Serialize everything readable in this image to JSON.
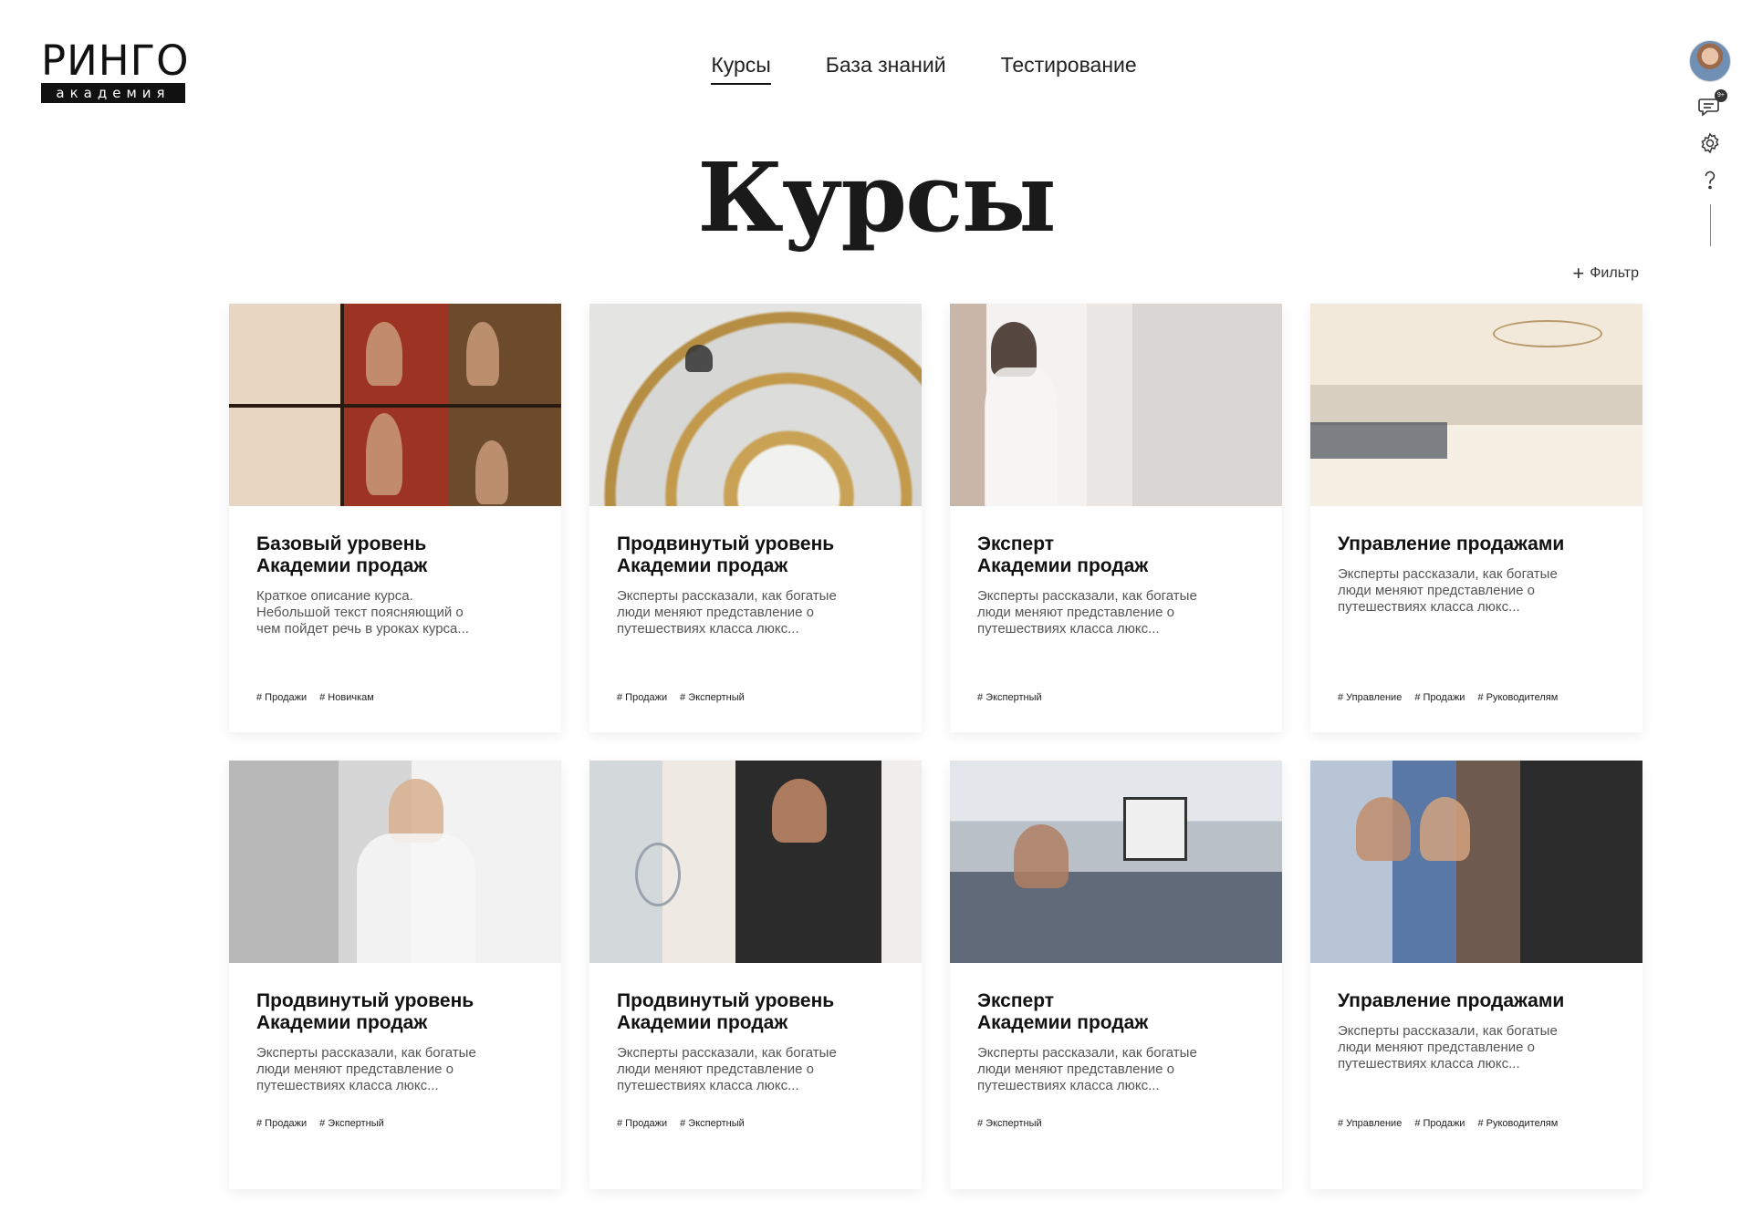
{
  "logo": {
    "top": "РИНГО",
    "bottom": "академия"
  },
  "nav": [
    {
      "label": "Курсы",
      "active": true
    },
    {
      "label": "База знаний",
      "active": false
    },
    {
      "label": "Тестирование",
      "active": false
    }
  ],
  "toolbar": {
    "badge": "9+"
  },
  "page_title": "Курсы",
  "filter_label": "Фильтр",
  "courses": [
    {
      "title": "Базовый уровень\nАкадемии продаж",
      "desc": "Краткое описание курса.\nНебольшой текст поясняющий о\nчем пойдет речь в уроках курса...",
      "tags": [
        "# Продажи",
        "# Новичкам"
      ]
    },
    {
      "title": "Продвинутый уровень\nАкадемии продаж",
      "desc": "Эксперты рассказали, как богатые\nлюди меняют представление о\nпутешествиях класса люкс...",
      "tags": [
        "# Продажи",
        "# Экспертный"
      ]
    },
    {
      "title": "Эксперт\nАкадемии продаж",
      "desc": "Эксперты рассказали, как богатые\nлюди меняют представление о\nпутешествиях класса люкс...",
      "tags": [
        "# Экспертный"
      ]
    },
    {
      "title": "Управление продажами",
      "desc": "Эксперты рассказали, как богатые\nлюди меняют представление о\nпутешествиях класса люкс...",
      "tags": [
        "# Управление",
        "# Продажи",
        "# Руководителям"
      ]
    },
    {
      "title": "Продвинутый уровень\nАкадемии продаж",
      "desc": "Эксперты рассказали, как богатые\nлюди меняют представление о\nпутешествиях класса люкс...",
      "tags": [
        "# Продажи",
        "# Экспертный"
      ]
    },
    {
      "title": "Продвинутый уровень\nАкадемии продаж",
      "desc": "Эксперты рассказали, как богатые\nлюди меняют представление о\nпутешествиях класса люкс...",
      "tags": [
        "# Продажи",
        "# Экспертный"
      ]
    },
    {
      "title": "Эксперт\nАкадемии продаж",
      "desc": "Эксперты рассказали, как богатые\nлюди меняют представление о\nпутешествиях класса люкс...",
      "tags": [
        "# Экспертный"
      ]
    },
    {
      "title": "Управление продажами",
      "desc": "Эксперты рассказали, как богатые\nлюди меняют представление о\nпутешествиях класса люкс...",
      "tags": [
        "# Управление",
        "# Продажи",
        "# Руководителям"
      ]
    }
  ]
}
